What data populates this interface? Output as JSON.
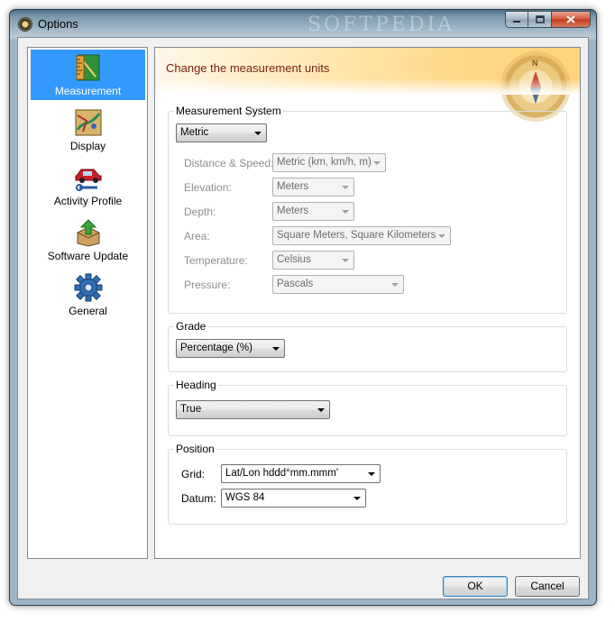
{
  "window": {
    "title": "Options",
    "watermark": "SOFTPEDIA"
  },
  "sidebar": {
    "items": [
      {
        "label": "Measurement",
        "icon": "ruler-map-icon",
        "selected": true
      },
      {
        "label": "Display",
        "icon": "map-display-icon",
        "selected": false
      },
      {
        "label": "Activity Profile",
        "icon": "car-wrench-icon",
        "selected": false
      },
      {
        "label": "Software Update",
        "icon": "update-box-icon",
        "selected": false
      },
      {
        "label": "General",
        "icon": "gear-icon",
        "selected": false
      }
    ]
  },
  "panel": {
    "banner_title": "Change the measurement units",
    "measurement_system": {
      "legend": "Measurement System",
      "value": "Metric",
      "rows": [
        {
          "label": "Distance & Speed:",
          "value": "Metric (km, km/h, m)"
        },
        {
          "label": "Elevation:",
          "value": "Meters"
        },
        {
          "label": "Depth:",
          "value": "Meters"
        },
        {
          "label": "Area:",
          "value": "Square Meters, Square Kilometers"
        },
        {
          "label": "Temperature:",
          "value": "Celsius"
        },
        {
          "label": "Pressure:",
          "value": "Pascals"
        }
      ]
    },
    "grade": {
      "legend": "Grade",
      "value": "Percentage (%)"
    },
    "heading": {
      "legend": "Heading",
      "value": "True"
    },
    "position": {
      "legend": "Position",
      "grid_label": "Grid:",
      "grid_value": "Lat/Lon hddd°mm.mmm'",
      "datum_label": "Datum:",
      "datum_value": "WGS 84"
    }
  },
  "buttons": {
    "ok": "OK",
    "cancel": "Cancel"
  },
  "colors": {
    "selection": "#3399ff",
    "banner_title": "#7a1f10"
  }
}
